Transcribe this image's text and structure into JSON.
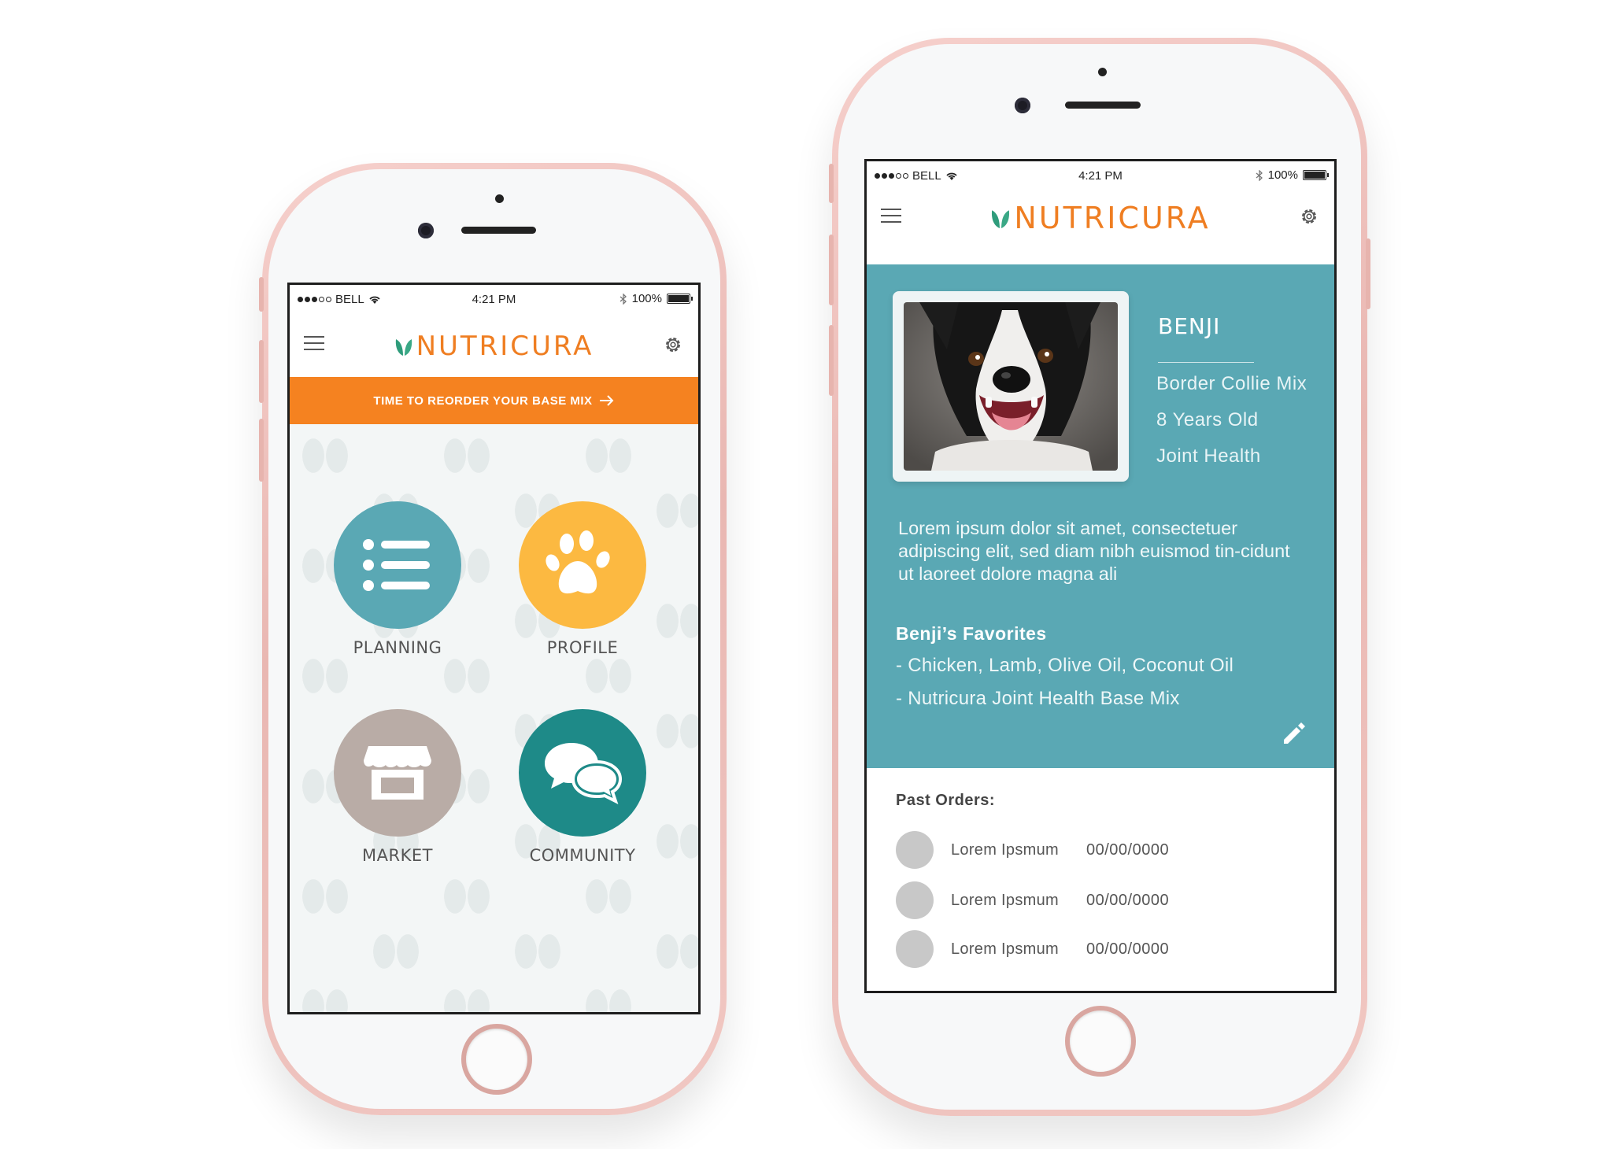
{
  "status_bar": {
    "carrier": "BELL",
    "time": "4:21 PM",
    "battery": "100%"
  },
  "brand": {
    "name": "NUTRICURA",
    "orange": "#ef7e22",
    "green": "#2f9c7b",
    "teal": "#5aa8b4"
  },
  "home_screen": {
    "banner": "TIME TO REORDER YOUR BASE MIX",
    "tiles": [
      {
        "label": "PLANNING",
        "color": "#5aa8b4",
        "icon": "list-icon"
      },
      {
        "label": "PROFILE",
        "color": "#fcb941",
        "icon": "paw-icon"
      },
      {
        "label": "MARKET",
        "color": "#b9aca6",
        "icon": "storefront-icon"
      },
      {
        "label": "COMMUNITY",
        "color": "#1e8a88",
        "icon": "chat-bubbles-icon"
      }
    ]
  },
  "profile_screen": {
    "pet_name": "BENJI",
    "details": [
      "Border Collie Mix",
      "8 Years Old",
      "Joint Health"
    ],
    "description": "Lorem ipsum dolor sit amet, consectetuer adipiscing elit, sed diam  nibh euismod tin-cidunt ut laoreet dolore magna ali",
    "favorites_title": "Benji’s Favorites",
    "favorites": [
      "- Chicken, Lamb, Olive Oil, Coconut Oil",
      "- Nutricura Joint Health Base Mix"
    ],
    "past_orders_title": "Past Orders:",
    "orders": [
      {
        "name": "Lorem Ipsmum",
        "date": "00/00/0000"
      },
      {
        "name": "Lorem Ipsmum",
        "date": "00/00/0000"
      },
      {
        "name": "Lorem Ipsmum",
        "date": "00/00/0000"
      }
    ]
  }
}
